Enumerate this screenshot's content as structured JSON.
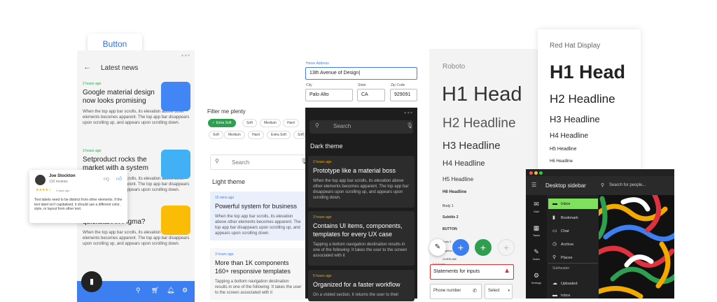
{
  "button_chip": {
    "label": "Button"
  },
  "news": {
    "title": "Latest news",
    "articles": [
      {
        "time": "2 hours ago",
        "headline": "Google material design now looks promising",
        "body": "When the top app bar scrolls, its elevation above other elements becomes apparent. The top app bar disappears upon scrolling up, and appears upon scrolling down.",
        "thumb_color": "#4285f4"
      },
      {
        "time": "3 hours ago",
        "headline": "Setproduct rocks the market with a system",
        "body": "When the top app bar scrolls, its elevation above other elements becomes apparent. The top app bar disappears upon scrolling up, and appears upon scrolling down.",
        "thumb_color": "#42b0f4"
      },
      {
        "time": "",
        "headline": "quickstart in Figma?",
        "body": "When the top app bar scrolls, its elevation above other elements becomes apparent. The top app bar disappears upon scrolling up, and appears upon scrolling down.",
        "thumb_color": "#fbbc05"
      }
    ],
    "nav_icons": [
      "search-icon",
      "cart-icon",
      "bell-icon",
      "gear-icon"
    ],
    "nav_color": "#3d7ff0"
  },
  "review": {
    "name": "Joe Stockton",
    "count": "133 reviews",
    "rating": 4,
    "time": "3 days ago",
    "text": "Text labels need to be distinct from other elements. If the text label isn't capitalized, it should use a different color, style, or layout from other text."
  },
  "filter": {
    "label": "Filter me plenty",
    "row1": [
      "Extra Soft",
      "Soft",
      "Medium",
      "Hard",
      "Extra Hard"
    ],
    "row2": [
      "Soft",
      "Medium",
      "Hard",
      "Extra Soft",
      "Soft"
    ],
    "selected": "Extra Soft"
  },
  "address": {
    "home_label": "Home Address",
    "home_value": "13th Avenue of Design|",
    "city_label": "City",
    "city_value": "Palo Alto",
    "state_label": "State",
    "state_value": "CA",
    "zip_label": "Zip Code",
    "zip_value": "929091"
  },
  "light": {
    "search_placeholder": "Search",
    "title": "Light theme",
    "cards": [
      {
        "time": "15 mins ago",
        "headline": "Powerful system for business",
        "body": "When the top app bar scrolls, its elevation above other elements becomes apparent. The top app bar disappears upon scrolling up, and appears upon scrolling down."
      },
      {
        "time": "3 hours ago",
        "headline": "More than 1K components 160+ responsive templates",
        "body": "Tapping a bottom navigation destination results in one of the following: It takes the user to the screen associated with it"
      }
    ]
  },
  "dark": {
    "search_placeholder": "Search",
    "title": "Dark theme",
    "cards": [
      {
        "time": "2 hours ago",
        "headline": "Prototype like a material boss",
        "body": "When the top app bar scrolls, its elevation above other elements becomes apparent. The top app bar disappears upon scrolling up, and appears upon scrolling down."
      },
      {
        "time": "3 hours ago",
        "headline": "Contains UI items, components, templates for every UX case",
        "body": "Tapping a bottom navigation destination results in one of the following: It takes the user to the screen associated with it"
      },
      {
        "time": "5 hours ago",
        "headline": "Organized for a faster workflow",
        "body": "On a visited section, it returns the user to their"
      }
    ]
  },
  "roboto": {
    "font_label": "Roboto",
    "h1": "H1 Head",
    "h2": "H2 Headline",
    "h3": "H3 Headline",
    "h4": "H4 Headline",
    "h5": "H5 Headline",
    "h6": "H6 Headline",
    "body1": "Body 1",
    "subtitle2": "Subtitle 2",
    "body2": "Body 2",
    "button": "BUTTON",
    "caption": "Caption",
    "overline": "OVERLINE",
    "error_label": "Full Name",
    "error_value": "Statements for inputs",
    "phone_placeholder": "Phone number",
    "select_value": "Select"
  },
  "redhat": {
    "font_label": "Red Hat Display",
    "h1": "H1 Head",
    "h2": "H2 Headline",
    "h3": "H3 Headline",
    "h4": "H4 Headline",
    "h5": "H5 Headline",
    "h6": "H6 Headline"
  },
  "desktop": {
    "title": "Desktop sidebar",
    "search_placeholder": "Search for people...",
    "rail": [
      "Mail",
      "Tasks",
      "Notes",
      "Settings"
    ],
    "items": [
      "Inbox",
      "Bookmark",
      "Chat",
      "Archive",
      "Places"
    ],
    "subheader": "Subheader",
    "items2": [
      "Uploaded",
      "Inbox"
    ],
    "accent": "#7ee05c"
  }
}
